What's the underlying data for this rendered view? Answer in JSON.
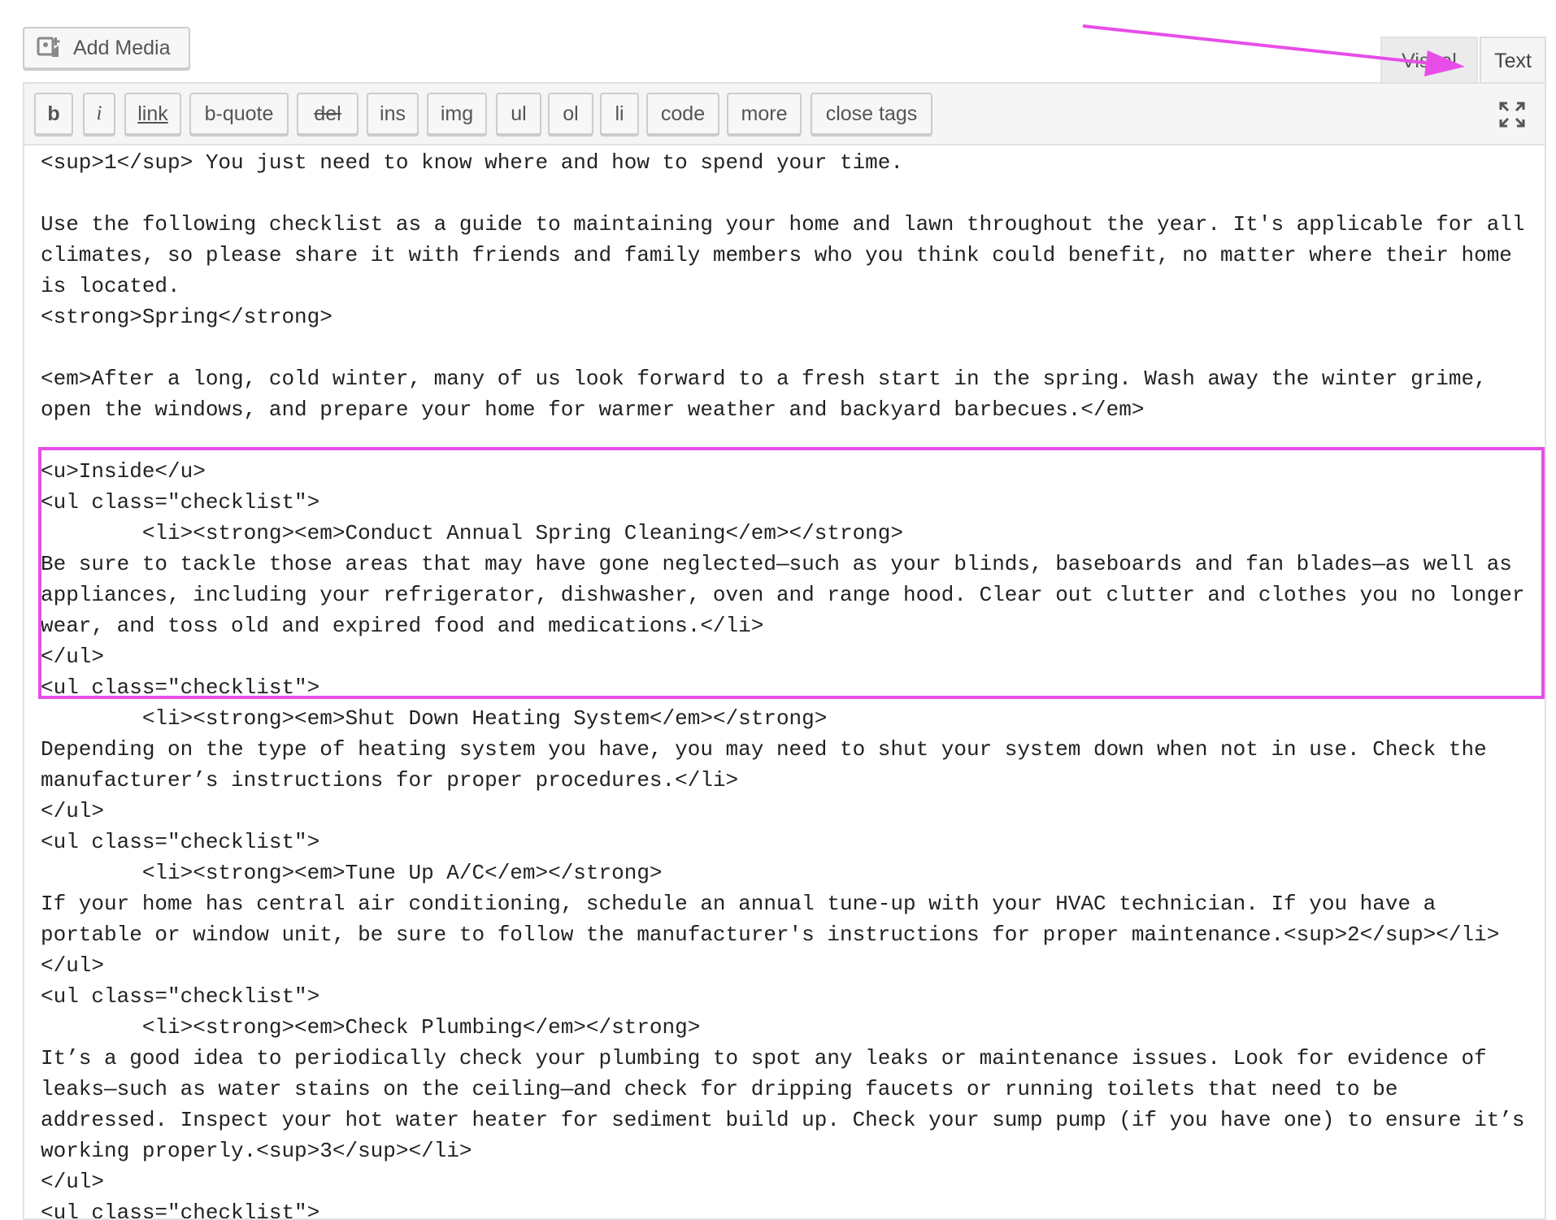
{
  "add_media": {
    "label": "Add Media",
    "icon": "add-media-icon"
  },
  "tabs": {
    "visual": "Visual",
    "text": "Text",
    "active": "text"
  },
  "toolbar": {
    "buttons": [
      {
        "name": "qt-bold-button",
        "label": "b"
      },
      {
        "name": "qt-italic-button",
        "label": "i"
      },
      {
        "name": "qt-link-button",
        "label": "link"
      },
      {
        "name": "qt-blockquote-button",
        "label": "b-quote"
      },
      {
        "name": "qt-del-button",
        "label": "del"
      },
      {
        "name": "qt-ins-button",
        "label": "ins"
      },
      {
        "name": "qt-img-button",
        "label": "img"
      },
      {
        "name": "qt-ul-button",
        "label": "ul"
      },
      {
        "name": "qt-ol-button",
        "label": "ol"
      },
      {
        "name": "qt-li-button",
        "label": "li"
      },
      {
        "name": "qt-code-button",
        "label": "code"
      },
      {
        "name": "qt-more-button",
        "label": "more"
      },
      {
        "name": "qt-close-tags-button",
        "label": "close tags"
      }
    ],
    "fullscreen_icon": "expand-icon"
  },
  "editor": {
    "lines": [
      "<sup>1</sup> You just need to know where and how to spend your time.",
      "",
      "Use the following checklist as a guide to maintaining your home and lawn throughout the year. It's applicable for all",
      "climates, so please share it with friends and family members who you think could benefit, no matter where their home",
      "is located.",
      "<strong>Spring</strong>",
      "",
      "<em>After a long, cold winter, many of us look forward to a fresh start in the spring. Wash away the winter grime,",
      "open the windows, and prepare your home for warmer weather and backyard barbecues.</em>",
      "",
      "<u>Inside</u>",
      "<ul class=\"checklist\">",
      "        <li><strong><em>Conduct Annual Spring Cleaning</em></strong>",
      "Be sure to tackle those areas that may have gone neglected—such as your blinds, baseboards and fan blades—as well as",
      "appliances, including your refrigerator, dishwasher, oven and range hood. Clear out clutter and clothes you no longer",
      "wear, and toss old and expired food and medications.</li>",
      "</ul>",
      "<ul class=\"checklist\">",
      "        <li><strong><em>Shut Down Heating System</em></strong>",
      "Depending on the type of heating system you have, you may need to shut your system down when not in use. Check the",
      "manufacturer’s instructions for proper procedures.</li>",
      "</ul>",
      "<ul class=\"checklist\">",
      "        <li><strong><em>Tune Up A/C</em></strong>",
      "If your home has central air conditioning, schedule an annual tune-up with your HVAC technician. If you have a",
      "portable or window unit, be sure to follow the manufacturer's instructions for proper maintenance.<sup>2</sup></li>",
      "</ul>",
      "<ul class=\"checklist\">",
      "        <li><strong><em>Check Plumbing</em></strong>",
      "It’s a good idea to periodically check your plumbing to spot any leaks or maintenance issues. Look for evidence of",
      "leaks—such as water stains on the ceiling—and check for dripping faucets or running toilets that need to be",
      "addressed. Inspect your hot water heater for sediment build up. Check your sump pump (if you have one) to ensure it’s",
      "working properly.<sup>3</sup></li>",
      "</ul>",
      "<ul class=\"checklist\">"
    ]
  },
  "colors": {
    "annotation": "#e84de8"
  }
}
